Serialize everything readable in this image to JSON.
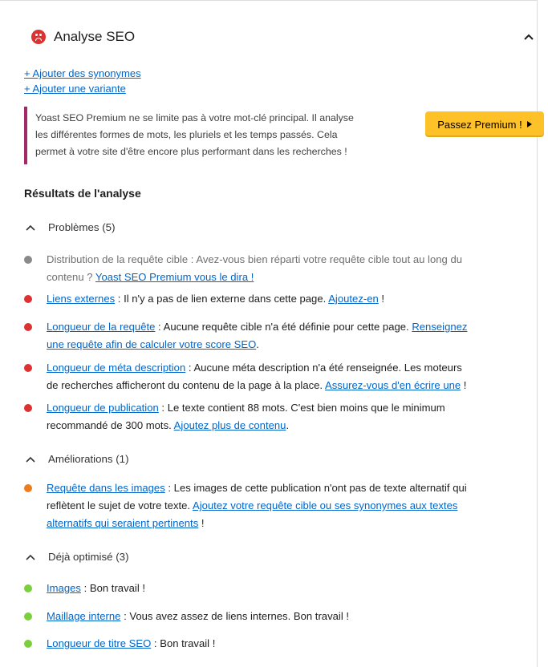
{
  "header": {
    "title": "Analyse SEO",
    "status_icon": "sad-face-icon",
    "status_color": "#dc3232"
  },
  "links": {
    "add_synonyms": "+ Ajouter des synonymes",
    "add_variant": "+ Ajouter une variante"
  },
  "promo": {
    "line1": "Yoast SEO Premium ne se limite pas à votre mot-clé principal. Il analyse",
    "line2": "les différentes formes de mots, les pluriels et les temps passés. Cela",
    "line3": "permet à votre site d'être encore plus performant dans les recherches !",
    "button": "Passez Premium !",
    "accent": "#a4286a",
    "button_color": "#fec228"
  },
  "results_title": "Résultats de l'analyse",
  "groups": {
    "problems": "Problèmes (5)",
    "improvements": "Améliorations (1)",
    "good": "Déjà optimisé (3)"
  },
  "items": {
    "distribution": {
      "text1": "Distribution de la requête cible : Avez-vous bien réparti votre requête cible tout au long du",
      "text2": "contenu ? ",
      "link": "Yoast SEO Premium vous le dira !"
    },
    "external": {
      "link": "Liens externes",
      "text": " : Il n'y a pas de lien externe dans cette page. ",
      "action": "Ajoutez-en",
      "end": " !"
    },
    "keyphrase_length": {
      "link": "Longueur de la requête",
      "text": " : Aucune requête cible n'a été définie pour cette page. ",
      "action1": "Renseignez",
      "action2": "une requête afin de calculer votre score SEO",
      "end": "."
    },
    "meta_length": {
      "link": "Longueur de méta description",
      "text1": " : Aucune méta description n'a été renseignée. Les moteurs",
      "text2": "de recherches afficheront du contenu de la page à la place. ",
      "action": "Assurez-vous d'en écrire une",
      "end": " !"
    },
    "text_length": {
      "link": "Longueur de publication",
      "text1": " : Le texte contient 88 mots. C'est bien moins que le minimum",
      "text2": "recommandé de 300 mots. ",
      "action": "Ajoutez plus de contenu",
      "end": "."
    },
    "image_keyphrase": {
      "link": "Requête dans les images",
      "text1": " : Les images de cette publication n'ont pas de texte alternatif qui",
      "text2": "reflètent le sujet de votre texte. ",
      "action1": "Ajoutez votre requête cible ou ses synonymes aux textes",
      "action2": "alternatifs qui seraient pertinents",
      "end": " !"
    },
    "images": {
      "link": "Images",
      "text": " : Bon travail !"
    },
    "internal": {
      "link": "Maillage interne",
      "text": " : Vous avez assez de liens internes. Bon travail !"
    },
    "title_length": {
      "link": "Longueur de titre SEO",
      "text": " : Bon travail !"
    }
  },
  "colors": {
    "problem": "#dc3232",
    "improvement": "#ee7c1b",
    "good": "#7ad03a",
    "grey": "#8a8a8a",
    "link": "#0066cc"
  }
}
